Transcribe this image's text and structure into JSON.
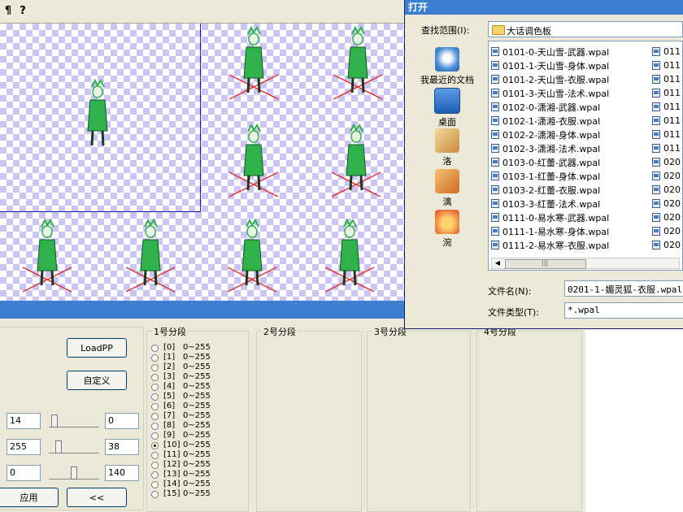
{
  "toolbar": {
    "help_icon_glyph": "?",
    "left_glyph": "¶"
  },
  "buttons": {
    "loadpp": "LoadPP",
    "custom": "自定义",
    "apply": "应用",
    "collapse": "<<"
  },
  "color_fields": [
    {
      "left": "14",
      "right": "0",
      "level": 0.05
    },
    {
      "left": "255",
      "right": "38",
      "level": 0.15
    },
    {
      "left": "0",
      "right": "140",
      "level": 0.5
    }
  ],
  "segments": {
    "seg1_title": "1号分段",
    "seg2_title": "2号分段",
    "seg3_title": "3号分段",
    "seg4_title": "4号分段",
    "selected_index": 10,
    "rows": [
      {
        "idx": "[0]",
        "range": "0~255"
      },
      {
        "idx": "[1]",
        "range": "0~255"
      },
      {
        "idx": "[2]",
        "range": "0~255"
      },
      {
        "idx": "[3]",
        "range": "0~255"
      },
      {
        "idx": "[4]",
        "range": "0~255"
      },
      {
        "idx": "[5]",
        "range": "0~255"
      },
      {
        "idx": "[6]",
        "range": "0~255"
      },
      {
        "idx": "[7]",
        "range": "0~255"
      },
      {
        "idx": "[8]",
        "range": "0~255"
      },
      {
        "idx": "[9]",
        "range": "0~255"
      },
      {
        "idx": "[10]",
        "range": "0~255"
      },
      {
        "idx": "[11]",
        "range": "0~255"
      },
      {
        "idx": "[12]",
        "range": "0~255"
      },
      {
        "idx": "[13]",
        "range": "0~255"
      },
      {
        "idx": "[14]",
        "range": "0~255"
      },
      {
        "idx": "[15]",
        "range": "0~255"
      }
    ]
  },
  "dialog": {
    "title": "打开",
    "lookin_label": "查找范围(I):",
    "lookin_value": "大话调色板",
    "places": [
      "我最近的文档",
      "桌面",
      "洛",
      "漓",
      "涴"
    ],
    "files": [
      "0101-0-天山雪-武器.wpal",
      "0101-1-天山雪-身体.wpal",
      "0101-2-天山雪-衣服.wpal",
      "0101-3-天山雪-法术.wpal",
      "0102-0-潇湘-武器.wpal",
      "0102-1-潇湘-衣服.wpal",
      "0102-2-潇湘-身体.wpal",
      "0102-3-潇湘-法术.wpal",
      "0103-0-红蕾-武器.wpal",
      "0103-1-红蕾-身体.wpal",
      "0103-2-红蕾-衣服.wpal",
      "0103-3-红蕾-法术.wpal",
      "0111-0-易水寒-武器.wpal",
      "0111-1-易水寒-身体.wpal",
      "0111-2-易水寒-衣服.wpal"
    ],
    "files_col2": [
      "011",
      "011",
      "011",
      "011",
      "011",
      "011",
      "011",
      "011",
      "020",
      "020",
      "020",
      "020",
      "020",
      "020",
      "020"
    ],
    "filename_label": "文件名(N):",
    "filename_value": "0201-1-媚灵狐-衣服.wpal",
    "filetype_label": "文件类型(T):",
    "filetype_value": "*.wpal"
  },
  "colors": {
    "accent": "#3c7fd1",
    "checker": "#cbc4f4",
    "sprite_green": "#2fb24a",
    "marker_red": "#e03030"
  }
}
